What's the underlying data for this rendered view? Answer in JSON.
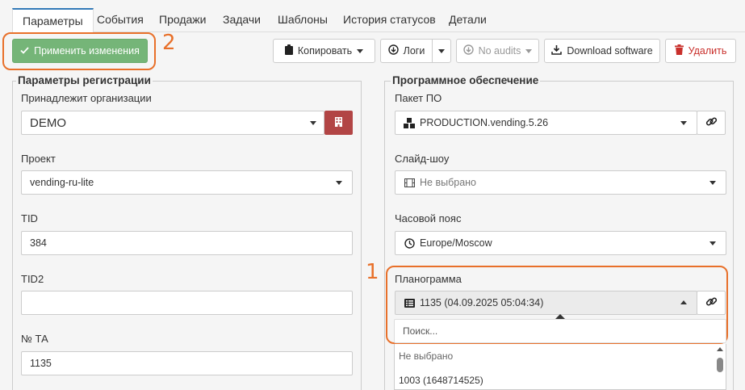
{
  "tabs": [
    {
      "label": "Параметры",
      "active": true
    },
    {
      "label": "События"
    },
    {
      "label": "Продажи"
    },
    {
      "label": "Задачи"
    },
    {
      "label": "Шаблоны"
    },
    {
      "label": "История статусов"
    },
    {
      "label": "Детали"
    }
  ],
  "toolbar": {
    "apply_label": "Применить изменения",
    "copy_label": "Копировать",
    "logs_label": "Логи",
    "no_audits_label": "No audits",
    "download_label": "Download software",
    "delete_label": "Удалить"
  },
  "annotations": {
    "one": "1",
    "two": "2"
  },
  "registration": {
    "legend": "Параметры регистрации",
    "org_label": "Принадлежит организации",
    "org_value": "DEMO",
    "project_label": "Проект",
    "project_value": "vending-ru-lite",
    "tid_label": "TID",
    "tid_value": "384",
    "tid2_label": "TID2",
    "tid2_value": "",
    "ta_label": "№ ТА",
    "ta_value": "1135"
  },
  "software": {
    "legend": "Программное обеспечение",
    "package_label": "Пакет ПО",
    "package_value": "PRODUCTION.vending.5.26",
    "slideshow_label": "Слайд-шоу",
    "slideshow_value": "Не выбрано",
    "timezone_label": "Часовой пояс",
    "timezone_value": "Europe/Moscow",
    "planogram_label": "Планограмма",
    "planogram_value": "1135 (04.09.2025 05:04:34)",
    "search_placeholder": "Поиск...",
    "options": [
      "Не выбрано",
      "1003 (1648714525)"
    ]
  },
  "colors": {
    "accent": "#337ab7",
    "success": "#75b578",
    "danger": "#c9302c",
    "annotation": "#e8702a"
  }
}
